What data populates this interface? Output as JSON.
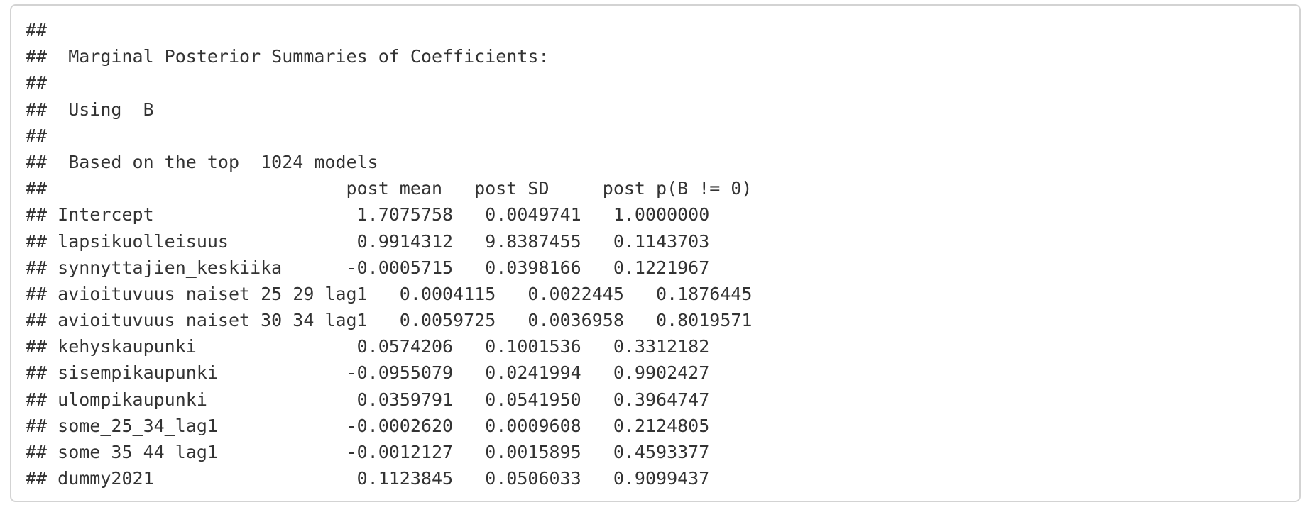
{
  "output": {
    "lines": [
      "##",
      "##  Marginal Posterior Summaries of Coefficients:",
      "##",
      "##  Using  B",
      "##",
      "##  Based on the top  1024 models",
      "##                            post mean   post SD     post p(B != 0)",
      "## Intercept                   1.7075758   0.0049741   1.0000000",
      "## lapsikuolleisuus            0.9914312   9.8387455   0.1143703",
      "## synnyttajien_keskiika      -0.0005715   0.0398166   0.1221967",
      "## avioituvuus_naiset_25_29_lag1   0.0004115   0.0022445   0.1876445",
      "## avioituvuus_naiset_30_34_lag1   0.0059725   0.0036958   0.8019571",
      "## kehyskaupunki               0.0574206   0.1001536   0.3312182",
      "## sisempikaupunki            -0.0955079   0.0241994   0.9902427",
      "## ulompikaupunki              0.0359791   0.0541950   0.3964747",
      "## some_25_34_lag1            -0.0002620   0.0009608   0.2124805",
      "## some_35_44_lag1            -0.0012127   0.0015895   0.4593377",
      "## dummy2021                   0.1123845   0.0506033   0.9099437"
    ]
  }
}
